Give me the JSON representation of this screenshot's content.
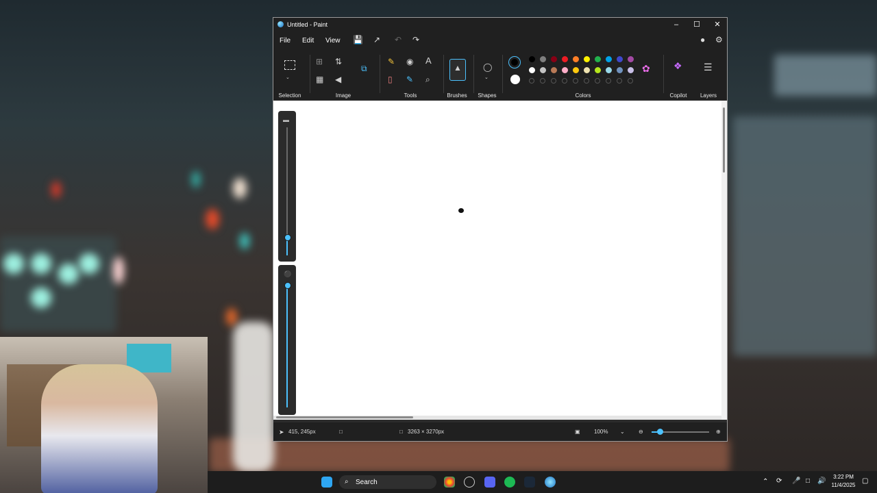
{
  "window": {
    "title": "Untitled - Paint",
    "minimize_icon": "minimize-icon",
    "maximize_icon": "maximize-icon",
    "close_icon": "close-icon"
  },
  "menu": [
    "File",
    "Edit",
    "View"
  ],
  "ribbon": {
    "groups": {
      "selection": "Selection",
      "image": "Image",
      "tools": "Tools",
      "brushes": "Brushes",
      "shapes": "Shapes",
      "colors": "Colors",
      "copilot": "Copilot",
      "layers": "Layers"
    },
    "tools_text_icon": "A",
    "palette_row1": [
      "#000000",
      "#7f7f7f",
      "#880015",
      "#ed1c24",
      "#ff7f27",
      "#fff200",
      "#22b14c",
      "#00a2e8",
      "#3f48cc",
      "#a349a4"
    ],
    "palette_row2": [
      "#ffffff",
      "#c3c3c3",
      "#b97a57",
      "#ffaec9",
      "#ffc90e",
      "#efe4b0",
      "#b5e61d",
      "#99d9ea",
      "#7092be",
      "#c8bfe7"
    ],
    "primary_color": "#000000",
    "secondary_color": "#ffffff"
  },
  "status": {
    "cursor_pos": "415, 245px",
    "canvas_size": "3263 × 3270px",
    "zoom": "100%"
  },
  "taskbar": {
    "search_placeholder": "Search",
    "time": "3:22 PM",
    "date": "11/4/2025"
  }
}
